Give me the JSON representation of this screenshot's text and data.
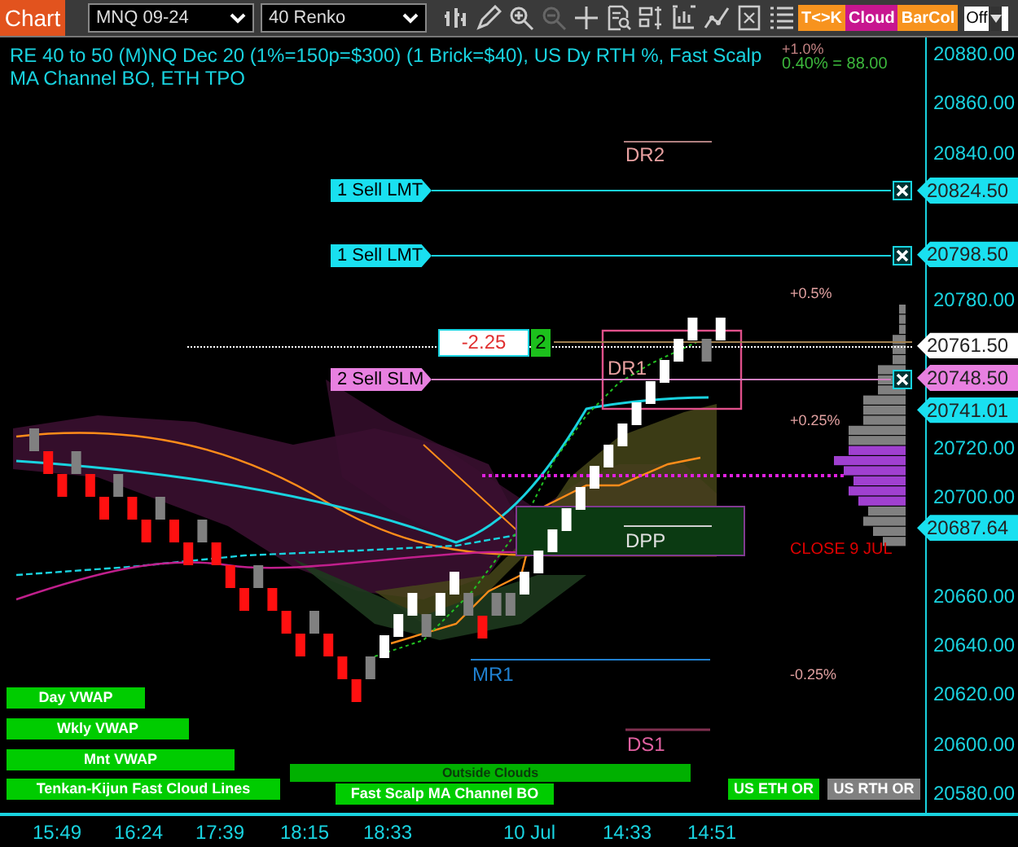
{
  "toolbar": {
    "chart_button": "Chart",
    "instrument": "MNQ 09-24",
    "bar_type": "40 Renko",
    "toggles": [
      {
        "label": "T<>K",
        "color": "#f7931e"
      },
      {
        "label": "Cloud",
        "color": "#c7168f"
      },
      {
        "label": "BarCol",
        "color": "#f7931e"
      }
    ],
    "mode_select": "Off"
  },
  "chart": {
    "title": "RE 40 to 50 (M)NQ Dec 20 (1%=150p=$300) (1 Brick=$40), US Dy RTH %, Fast Scalp MA Channel BO, ETH TPO",
    "percent_notes": [
      "+1.0%",
      "0.40% = 88.00"
    ],
    "levels": [
      {
        "label": "DR2",
        "kind": "resistance"
      },
      {
        "label": "DR1",
        "kind": "resistance"
      },
      {
        "label": "DPP",
        "kind": "pivot"
      },
      {
        "label": "MR1",
        "kind": "mid"
      },
      {
        "label": "DS1",
        "kind": "support"
      }
    ],
    "percent_levels": [
      "+0.5%",
      "+0.25%",
      "-0.25%"
    ],
    "close_label": "CLOSE 9 JUL",
    "orders": [
      {
        "label": "1 Sell LMT",
        "kind": "limit"
      },
      {
        "label": "1 Sell LMT",
        "kind": "limit"
      },
      {
        "label": "2 Sell SLM",
        "kind": "stop"
      }
    ],
    "position": {
      "pnl": "-2.25",
      "quantity": "2"
    },
    "indicator_buttons": [
      {
        "label": "Day VWAP",
        "kind": "green"
      },
      {
        "label": "Wkly VWAP",
        "kind": "green"
      },
      {
        "label": "Mnt VWAP",
        "kind": "green"
      },
      {
        "label": "Tenkan-Kijun Fast Cloud Lines",
        "kind": "green"
      },
      {
        "label": "Outside Clouds",
        "kind": "dark"
      },
      {
        "label": "Fast Scalp MA Channel BO",
        "kind": "green"
      },
      {
        "label": "US ETH OR",
        "kind": "green"
      },
      {
        "label": "US RTH OR",
        "kind": "gray"
      }
    ]
  },
  "price_axis": {
    "ticks": [
      "20880.00",
      "20860.00",
      "20840.00",
      "20780.00",
      "20720.00",
      "20700.00",
      "20660.00",
      "20640.00",
      "20620.00",
      "20600.00",
      "20580.00"
    ],
    "markers": [
      {
        "text": "20824.50",
        "kind": "order"
      },
      {
        "text": "20798.50",
        "kind": "order"
      },
      {
        "text": "20761.50",
        "kind": "last"
      },
      {
        "text": "20748.50",
        "kind": "stop"
      },
      {
        "text": "20741.01",
        "kind": "order"
      },
      {
        "text": "20687.64",
        "kind": "order"
      }
    ]
  },
  "time_axis": [
    "15:49",
    "16:24",
    "17:39",
    "18:15",
    "18:33",
    "10 Jul",
    "14:33",
    "14:51"
  ]
}
